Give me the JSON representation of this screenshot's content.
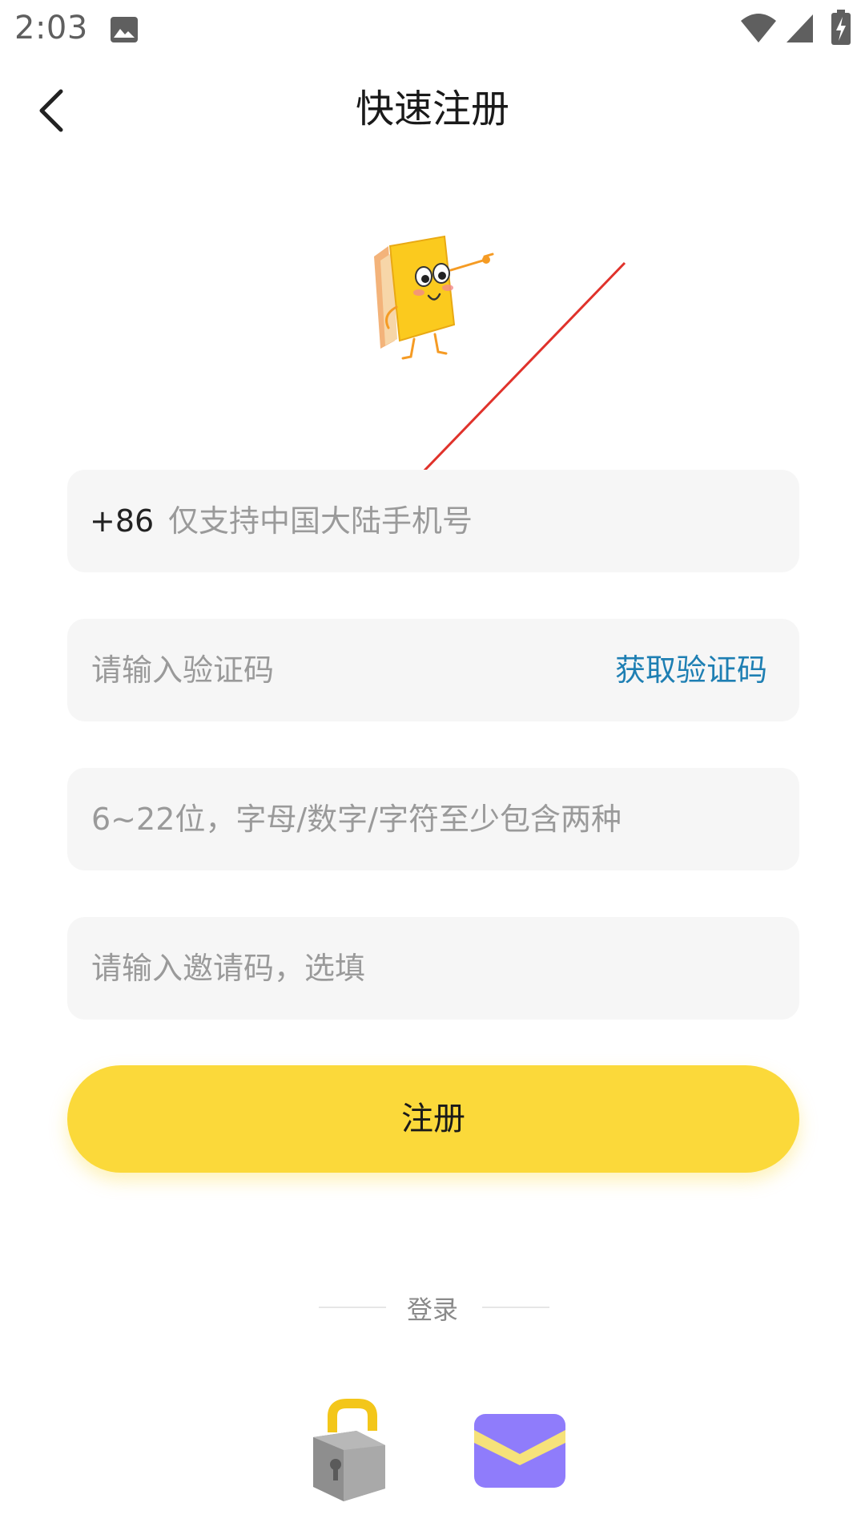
{
  "status_bar": {
    "time": "2:03",
    "icons": [
      "image-icon",
      "wifi-icon",
      "cell-signal-icon",
      "battery-charging-icon"
    ]
  },
  "header": {
    "title": "快速注册",
    "back_icon": "chevron-left-icon"
  },
  "form": {
    "phone": {
      "prefix": "+86",
      "placeholder": "仅支持中国大陆手机号",
      "value": ""
    },
    "verification": {
      "placeholder": "请输入验证码",
      "value": "",
      "get_code_label": "获取验证码"
    },
    "password": {
      "placeholder": "6~22位，字母/数字/字符至少包含两种",
      "value": ""
    },
    "invite": {
      "placeholder": "请输入邀请码，选填",
      "value": ""
    },
    "submit_label": "注册"
  },
  "login": {
    "divider_label": "登录",
    "methods": [
      "lock-icon",
      "mail-icon"
    ]
  },
  "colors": {
    "accent_yellow": "#fbd93a",
    "link_blue": "#1e7fb3",
    "field_bg": "#f6f6f6",
    "mail_purple": "#8f7cfb",
    "arrow_red": "#e0322b"
  }
}
